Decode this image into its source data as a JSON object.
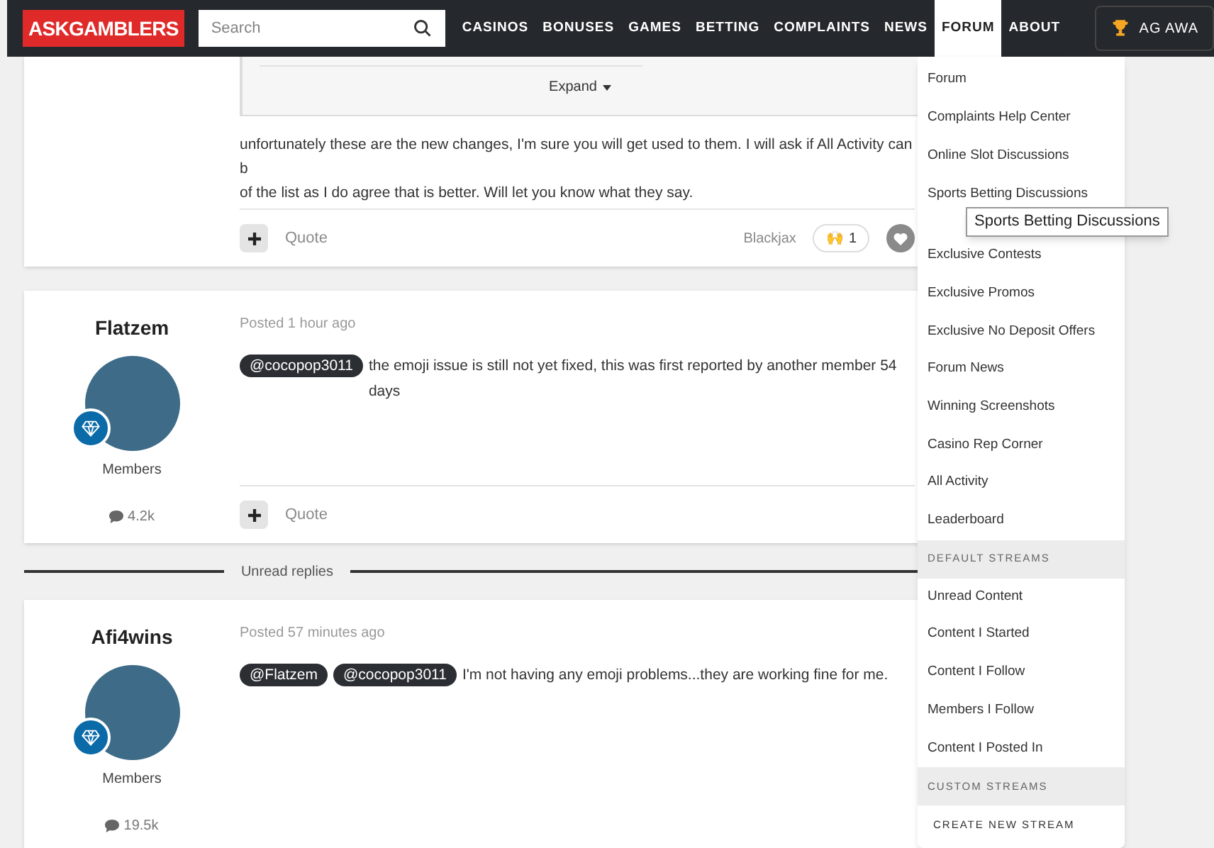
{
  "header": {
    "logo": "ASKGAMBLERS",
    "search": {
      "placeholder": "Search"
    },
    "nav": [
      {
        "label": "CASINOS",
        "selected": false
      },
      {
        "label": "BONUSES",
        "selected": false
      },
      {
        "label": "GAMES",
        "selected": false
      },
      {
        "label": "BETTING",
        "selected": false
      },
      {
        "label": "COMPLAINTS",
        "selected": false
      },
      {
        "label": "NEWS",
        "selected": false
      },
      {
        "label": "FORUM",
        "selected": true
      },
      {
        "label": "ABOUT",
        "selected": false
      }
    ],
    "awards_button": "AG AWA"
  },
  "posts": [
    {
      "kind": "quoted",
      "expand": "Expand",
      "lines": [
        "unfortunately these are the new changes, I'm sure you will get used to them. I will ask if All Activity can b",
        "of the list as I do agree that is better. Will let you know what they say."
      ],
      "quote": "Quote",
      "signature": "Blackjax",
      "reaction": {
        "emoji": "🙌",
        "count": "1"
      }
    },
    {
      "kind": "full",
      "author": "Flatzem",
      "posted": "Posted 1 hour ago",
      "group": "Members",
      "posts_count": "4.2k",
      "mentions": [
        "@cocopop3011"
      ],
      "text": "the emoji issue is still not yet fixed, this was first reported by another member 54 days",
      "quote": "Quote"
    },
    {
      "kind": "divider",
      "label": "Unread replies"
    },
    {
      "kind": "full",
      "author": "Afi4wins",
      "posted": "Posted 57 minutes ago",
      "group": "Members",
      "posts_count": "19.5k",
      "mentions": [
        "@Flatzem",
        "@cocopop3011"
      ],
      "text": "I'm not having any emoji problems...they are working fine for me."
    }
  ],
  "menu": {
    "items": [
      {
        "kind": "link",
        "label": "Forum"
      },
      {
        "kind": "link",
        "label": "Complaints Help Center"
      },
      {
        "kind": "link",
        "label": "Online Slot Discussions"
      },
      {
        "kind": "link",
        "label": "Sports Betting Discussions",
        "tooltip": "Sports Betting Discussions"
      },
      {
        "kind": "link",
        "label": "Exclusive Contests"
      },
      {
        "kind": "link",
        "label": "Exclusive Promos"
      },
      {
        "kind": "link",
        "label": "Exclusive No Deposit Offers"
      },
      {
        "kind": "link",
        "label": "Forum News"
      },
      {
        "kind": "link",
        "label": "Winning Screenshots"
      },
      {
        "kind": "link",
        "label": "Casino Rep Corner"
      },
      {
        "kind": "link",
        "label": "All Activity"
      },
      {
        "kind": "link",
        "label": "Leaderboard"
      },
      {
        "kind": "heading",
        "label": "DEFAULT STREAMS"
      },
      {
        "kind": "link",
        "label": "Unread Content"
      },
      {
        "kind": "link",
        "label": "Content I Started"
      },
      {
        "kind": "link",
        "label": "Content I Follow"
      },
      {
        "kind": "link",
        "label": "Members I Follow"
      },
      {
        "kind": "link",
        "label": "Content I Posted In"
      },
      {
        "kind": "heading",
        "label": "CUSTOM STREAMS"
      },
      {
        "kind": "action",
        "label": "CREATE NEW STREAM"
      }
    ]
  }
}
